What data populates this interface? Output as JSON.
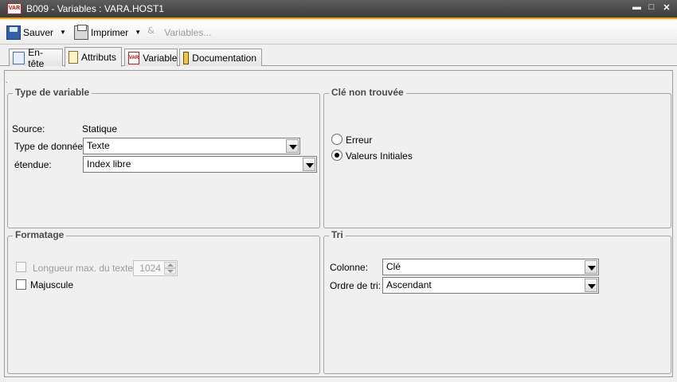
{
  "window": {
    "icon": "var-icon",
    "title": "B009 - Variables : VARA.HOST1",
    "controls": {
      "minimize": "▬",
      "maximize": "□",
      "close": "✕"
    }
  },
  "toolbar": {
    "save_label": "Sauver",
    "print_label": "Imprimer",
    "variables_label": "Variables...",
    "dropdown_arrow": "▼"
  },
  "tabs": [
    {
      "label": "En-tête",
      "icon": "header-icon",
      "active": false
    },
    {
      "label": "Attributs",
      "icon": "attributes-icon",
      "active": true
    },
    {
      "label": "Variable",
      "icon": "variable-icon",
      "active": false
    },
    {
      "label": "Documentation",
      "icon": "documentation-icon",
      "active": false
    }
  ],
  "content": {
    "dot": "."
  },
  "type_de_variable": {
    "title": "Type de variable",
    "source_label": "Source:",
    "source_value": "Statique",
    "data_type_label": "Type de donnée:",
    "data_type_value": "Texte",
    "scope_label": "étendue:",
    "scope_value": "Index libre"
  },
  "cle_non_trouvee": {
    "title": "Clé non trouvée",
    "options": [
      {
        "label": "Erreur",
        "checked": false
      },
      {
        "label": "Valeurs Initiales",
        "checked": true
      }
    ]
  },
  "formatage": {
    "title": "Formatage",
    "max_length_label": "Longueur max. du texte:",
    "max_length_value": "1024",
    "max_length_enabled": false,
    "uppercase_label": "Majuscule",
    "uppercase_checked": false
  },
  "tri": {
    "title": "Tri",
    "column_label": "Colonne:",
    "column_value": "Clé",
    "order_label": "Ordre de tri:",
    "order_value": "Ascendant"
  },
  "colors": {
    "title_bar": "#4a4a4a",
    "accent": "#f5a200",
    "background": "#f0f0f0",
    "group_border": "#a5a5a5"
  }
}
